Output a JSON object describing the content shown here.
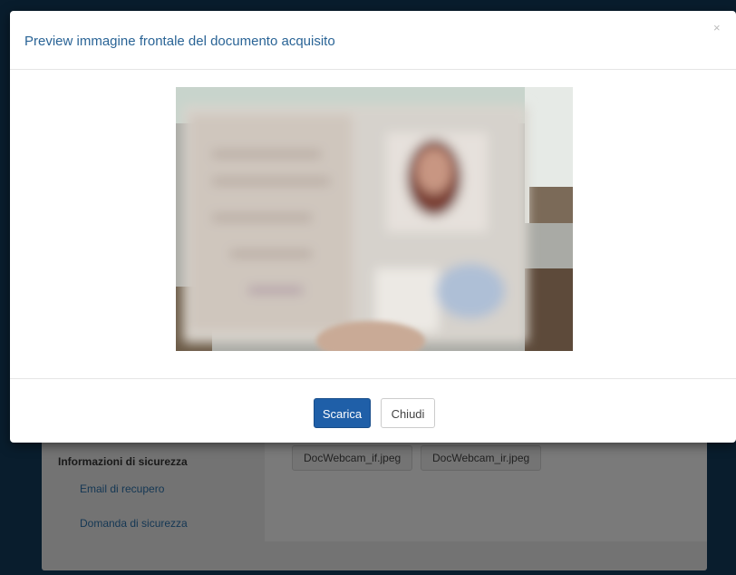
{
  "background": {
    "section_title": "Informazioni di sicurezza",
    "links": [
      "Email di recupero",
      "Domanda di sicurezza"
    ],
    "files": [
      "DocWebcam_if.jpeg",
      "DocWebcam_ir.jpeg"
    ]
  },
  "modal": {
    "title": "Preview immagine frontale del documento acquisito",
    "close_symbol": "×",
    "buttons": {
      "download": "Scarica",
      "close": "Chiudi"
    }
  },
  "colors": {
    "primary_button": "#1f5fa8",
    "title_text": "#2a6496"
  }
}
